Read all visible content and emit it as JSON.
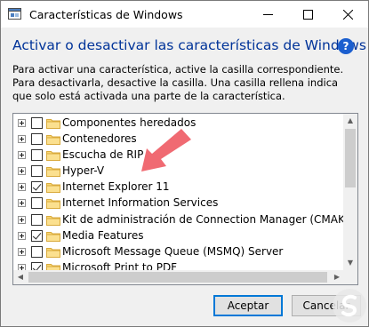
{
  "window": {
    "title": "Características de Windows",
    "controls": {
      "minimize": "—",
      "maximize": "☐",
      "close": "✕"
    }
  },
  "heading": "Activar o desactivar las características de Windows",
  "help": "?",
  "description": "Para activar una característica, active la casilla correspondiente. Para desactivarla, desactive la casilla. Una casilla rellena indica que solo está activada una parte de la característica.",
  "features": [
    {
      "label": "Componentes heredados",
      "expandable": true,
      "checked": false
    },
    {
      "label": "Contenedores",
      "expandable": true,
      "checked": false
    },
    {
      "label": "Escucha de RIP",
      "expandable": true,
      "checked": false
    },
    {
      "label": "Hyper-V",
      "expandable": true,
      "checked": false
    },
    {
      "label": "Internet Explorer 11",
      "expandable": true,
      "checked": true
    },
    {
      "label": "Internet Information Services",
      "expandable": true,
      "checked": false
    },
    {
      "label": "Kit de administración de Connection Manager (CMAK) de RA",
      "expandable": true,
      "checked": false
    },
    {
      "label": "Media Features",
      "expandable": true,
      "checked": true
    },
    {
      "label": "Microsoft Message Queue (MSMQ) Server",
      "expandable": true,
      "checked": false
    },
    {
      "label": "Microsoft Print to PDF",
      "expandable": true,
      "checked": true
    }
  ],
  "buttons": {
    "accept": "Aceptar",
    "cancel": "Cancelar"
  },
  "colors": {
    "heading": "#003399",
    "accent": "#0078d7",
    "arrow": "#f06a72"
  },
  "icons": {
    "app": "windows-features-icon",
    "help": "help-icon",
    "folder": "folder-icon",
    "arrow": "pointer-arrow-icon"
  }
}
